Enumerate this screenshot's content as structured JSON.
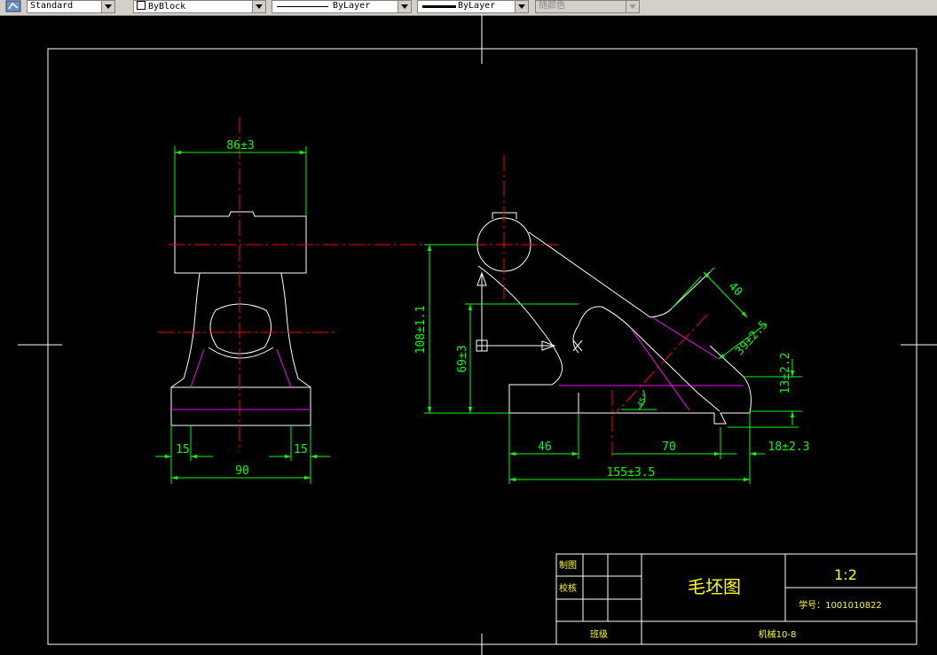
{
  "toolbar": {
    "text_style": "Standard",
    "color": "ByBlock",
    "linetype": "ByLayer",
    "lineweight": "ByLayer",
    "plot_style": "随颜色"
  },
  "drawing": {
    "dims": {
      "d86": "86±3",
      "d15a": "15",
      "d15b": "15",
      "d90": "90",
      "d108": "108±1.1",
      "d69": "69±3",
      "d46": "46",
      "d70": "70",
      "d155": "155±3.5",
      "d40": "40",
      "d39": "39±2.5",
      "d13": "13±2.2",
      "d18": "18±2.3",
      "dangle": "45°"
    },
    "title_block": {
      "drawn_label": "制图",
      "checked_label": "校核",
      "class_label": "班级",
      "title": "毛坯图",
      "scale": "1:2",
      "student_no": "学号：1001010822",
      "class_value": "机械10-8"
    }
  },
  "colors": {
    "background": "#000000",
    "outline": "#ffffff",
    "dimension": "#00ff00",
    "centerline": "#ff0000",
    "hidden": "#ff00ff",
    "text": "#ffff00"
  }
}
